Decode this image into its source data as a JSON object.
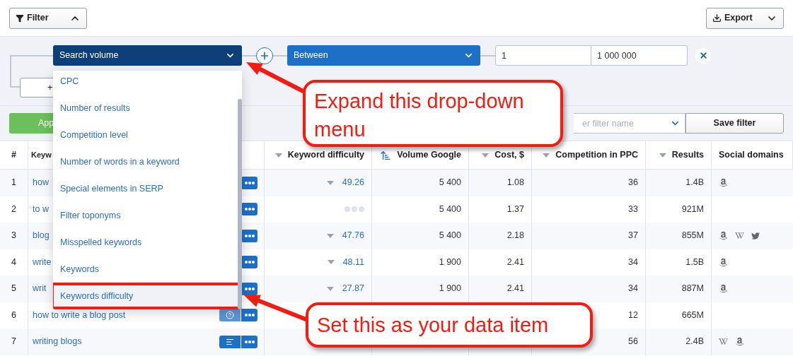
{
  "toolbar": {
    "filter_button": "Filter",
    "export_button": "Export"
  },
  "filter": {
    "field": "Search volume",
    "operator": "Between",
    "from": "1",
    "to": "1 000 000",
    "add_button": "+",
    "apply_button": "App",
    "name_field": {
      "placeholder": "er filter name"
    },
    "save_button": "Save filter"
  },
  "dropdown": {
    "items": [
      {
        "label": "CPC",
        "selected": false
      },
      {
        "label": "Number of results",
        "selected": false
      },
      {
        "label": "Competition level",
        "selected": false
      },
      {
        "label": "Number of words in a keyword",
        "selected": false
      },
      {
        "label": "Special elements in SERP",
        "selected": false
      },
      {
        "label": "Filter toponyms",
        "selected": false
      },
      {
        "label": "Misspelled keywords",
        "selected": false
      },
      {
        "label": "Keywords",
        "selected": false
      },
      {
        "label": "Keywords difficulty",
        "selected": true
      }
    ]
  },
  "table": {
    "columns": [
      {
        "label": "#",
        "kind": "plain"
      },
      {
        "label": "Keyw",
        "kind": "plain"
      },
      {
        "label": "Keyword difficulty",
        "kind": "sortable"
      },
      {
        "label": "Volume Google",
        "kind": "sorted"
      },
      {
        "label": "Cost, $",
        "kind": "sortable"
      },
      {
        "label": "Competition in PPC",
        "kind": "sortable"
      },
      {
        "label": "Results",
        "kind": "sortable"
      },
      {
        "label": "Social domains",
        "kind": "plain"
      }
    ],
    "rows": [
      {
        "number": "1",
        "keyword": "how",
        "difficulty": "49.26",
        "volume": "5 400",
        "cost": "1.08",
        "competition": "36",
        "results": "1.4B",
        "social": [
          {
            "kind": "amazon"
          }
        ]
      },
      {
        "number": "2",
        "keyword": "to w",
        "difficulty_loading": true,
        "volume": "5 400",
        "cost": "1.37",
        "competition": "33",
        "results": "921M",
        "social": []
      },
      {
        "number": "3",
        "keyword": "blog",
        "difficulty": "47.76",
        "volume": "5 400",
        "cost": "2.18",
        "competition": "37",
        "results": "855M",
        "social": [
          {
            "kind": "amazon"
          },
          {
            "kind": "wikipedia"
          },
          {
            "kind": "twitter"
          }
        ]
      },
      {
        "number": "4",
        "keyword": "write",
        "difficulty": "48.11",
        "volume": "1 900",
        "cost": "2.41",
        "competition": "34",
        "results": "1.5B",
        "social": [
          {
            "kind": "amazon"
          }
        ]
      },
      {
        "number": "5",
        "keyword": "writ",
        "difficulty": "27.87",
        "volume": "1 900",
        "cost": "2.41",
        "competition": "34",
        "results": "887M",
        "social": [
          {
            "kind": "amazon"
          }
        ]
      },
      {
        "number": "6",
        "keyword": "how to write a blog post",
        "info_button": {
          "kind": "help"
        },
        "competition": "12",
        "results": "665M",
        "social": []
      },
      {
        "number": "7",
        "keyword": "writing blogs",
        "info_button": {
          "kind": "list"
        },
        "competition": "56",
        "results": "2.4B",
        "social": [
          {
            "kind": "wikipedia"
          },
          {
            "kind": "amazon"
          }
        ]
      }
    ]
  },
  "callouts": [
    {
      "text": "Expand this drop-down menu"
    },
    {
      "text": "Set this as your data item"
    }
  ]
}
